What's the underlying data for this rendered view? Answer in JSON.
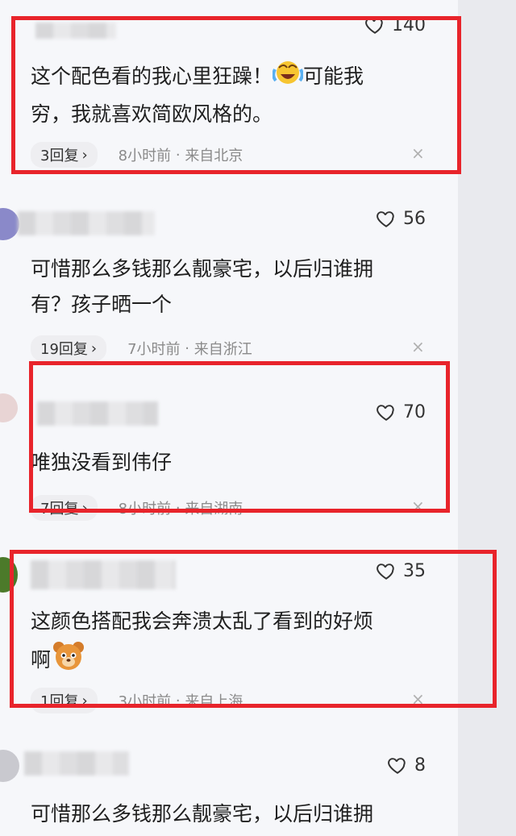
{
  "comments": [
    {
      "likes": "140",
      "text": "这个配色看的我心里狂躁！",
      "text2": "可能我",
      "text3": "穷，我就喜欢简欧风格的。",
      "replies": "3回复",
      "time": "8小时前",
      "location": "来自北京",
      "emoji": "crying-laughing-emoji"
    },
    {
      "likes": "56",
      "text": "可惜那么多钱那么靓豪宅，以后归谁拥",
      "text2": "有？孩子晒一个",
      "replies": "19回复",
      "time": "7小时前",
      "location": "来自浙江"
    },
    {
      "likes": "70",
      "text": "唯独没看到伟仔",
      "replies": "7回复",
      "time": "8小时前",
      "location": "来自湖南"
    },
    {
      "likes": "35",
      "text": "这颜色搭配我会奔溃太乱了看到的好烦",
      "text2": "啊",
      "replies": "1回复",
      "time": "3小时前",
      "location": "来自上海",
      "emoji": "bear-emoji"
    },
    {
      "likes": "8",
      "text": "可惜那么多钱那么靓豪宅，以后归谁拥"
    }
  ],
  "ui": {
    "separator": "·",
    "chevron": "›",
    "close": "×"
  },
  "colors": {
    "highlight": "#e8242b",
    "background": "#f6f7fa",
    "meta_text": "#8a8a8a"
  }
}
